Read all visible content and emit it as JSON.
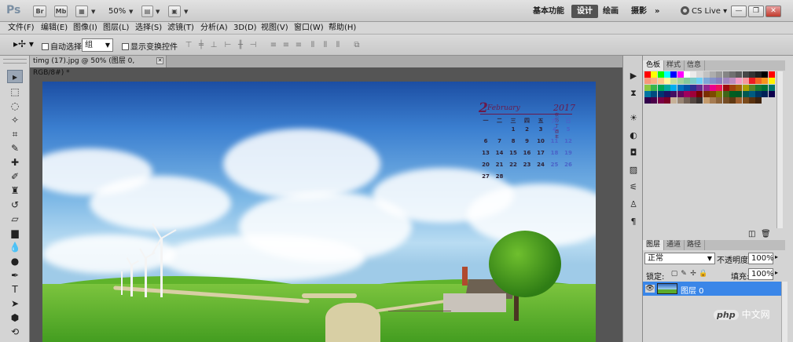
{
  "app": {
    "logo": "Ps",
    "bridge_btn": "Br",
    "minibridge_btn": "Mb",
    "zoom": "50%",
    "workspaces": [
      "基本功能",
      "设计",
      "绘画",
      "摄影"
    ],
    "more": "»",
    "cs_live": "CS Live",
    "window_buttons": [
      "—",
      "❐",
      "✕"
    ]
  },
  "menu": [
    "文件(F)",
    "编辑(E)",
    "图像(I)",
    "图层(L)",
    "选择(S)",
    "滤镜(T)",
    "分析(A)",
    "3D(D)",
    "视图(V)",
    "窗口(W)",
    "帮助(H)"
  ],
  "options": {
    "auto_select_label": "自动选择:",
    "auto_select_value": "组",
    "show_transform_label": "显示变换控件"
  },
  "document": {
    "tab_title": "timg (17).jpg @ 50% (图层 0, RGB/8#) *"
  },
  "calendar": {
    "day_number": "2",
    "month": "February",
    "year": "2017",
    "year_sub": "农历丁酉年",
    "weekdays": [
      "一",
      "二",
      "三",
      "四",
      "五",
      "六",
      "日"
    ],
    "weeks": [
      [
        "",
        "",
        "1",
        "2",
        "3",
        "4",
        "5"
      ],
      [
        "6",
        "7",
        "8",
        "9",
        "10",
        "11",
        "12"
      ],
      [
        "13",
        "14",
        "15",
        "16",
        "17",
        "18",
        "19"
      ],
      [
        "20",
        "21",
        "22",
        "23",
        "24",
        "25",
        "26"
      ],
      [
        "27",
        "28",
        "",
        "",
        "",
        "",
        ""
      ]
    ]
  },
  "panels": {
    "top_tabs": [
      "色板",
      "样式",
      "信息"
    ],
    "layer_tabs": [
      "图层",
      "通道",
      "路径"
    ],
    "blend_mode": "正常",
    "opacity_label": "不透明度:",
    "opacity_value": "100%",
    "lock_label": "锁定:",
    "fill_label": "填充:",
    "fill_value": "100%",
    "layer_name": "图层 0"
  },
  "watermark": {
    "badge": "php",
    "text": "中文网"
  }
}
